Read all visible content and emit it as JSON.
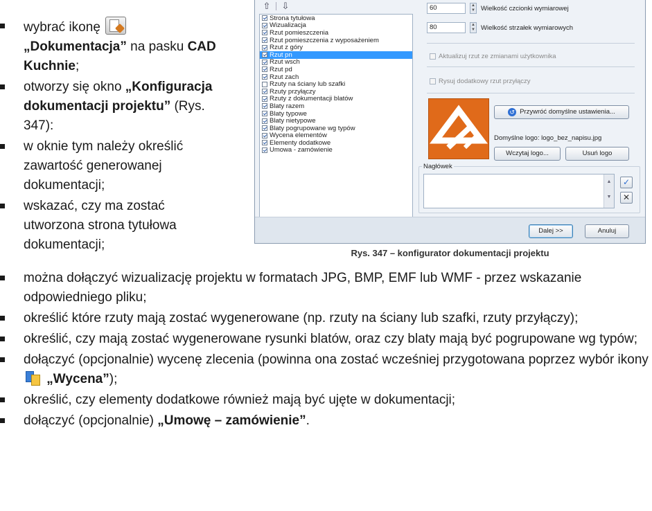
{
  "left_list": {
    "b1": {
      "pre": "wybrać ikonę",
      "bold": "„Dokumentacja”",
      "mid": "na pasku",
      "bold2": "CAD Kuchnie",
      "post": ";"
    },
    "b2": {
      "pre": "otworzy się okno",
      "bold": "„Konfiguracja dokumentacji projektu”",
      "post": "(Rys. 347):"
    },
    "b3": "w oknie tym należy określić zawartość generowanej dokumentacji;",
    "b4": "wskazać, czy ma zostać utworzona strona tytułowa dokumentacji;"
  },
  "bottom_list": {
    "b5": "można dołączyć wizualizację projektu w formatach JPG, BMP, EMF lub WMF - przez wskazanie odpowiedniego pliku;",
    "b6": "określić które rzuty mają zostać wygenerowane (np. rzuty na ściany lub szafki, rzuty przyłączy);",
    "b7": "określić, czy mają zostać wygenerowane rysunki blatów, oraz czy blaty mają być pogrupowane wg typów;",
    "b8": {
      "pre": "dołączyć (opcjonalnie) wycenę zlecenia (powinna ona zostać wcześniej przygotowana poprzez wybór ikony",
      "bold": "„Wycena”",
      "post": ");"
    },
    "b9": "określić, czy elementy dodatkowe również mają być ujęte w dokumentacji;",
    "b10": {
      "pre": "dołączyć (opcjonalnie)",
      "bold": "„Umowę – zamówienie”",
      "post": "."
    }
  },
  "icons": {
    "documentation": "documentation-icon",
    "valuation": "valuation-icon"
  },
  "dialog": {
    "items": [
      {
        "label": "Strona tytułowa",
        "checked": true
      },
      {
        "label": "Wizualizacja",
        "checked": true
      },
      {
        "label": "Rzut pomieszczenia",
        "checked": true
      },
      {
        "label": "Rzut pomieszczenia z wyposażeniem",
        "checked": true
      },
      {
        "label": "Rzut z góry",
        "checked": true
      },
      {
        "label": "Rzut pn",
        "checked": true,
        "selected": true
      },
      {
        "label": "Rzut wsch",
        "checked": true
      },
      {
        "label": "Rzut pd",
        "checked": true
      },
      {
        "label": "Rzut zach",
        "checked": true
      },
      {
        "label": "Rzuty na ściany lub szafki",
        "checked": false
      },
      {
        "label": "Rzuty przyłączy",
        "checked": true
      },
      {
        "label": "Rzuty z dokumentacji blatów",
        "checked": true
      },
      {
        "label": "Blaty razem",
        "checked": true
      },
      {
        "label": "Blaty typowe",
        "checked": true
      },
      {
        "label": "Blaty nietypowe",
        "checked": true
      },
      {
        "label": "Blaty pogrupowane wg typów",
        "checked": true
      },
      {
        "label": "Wycena elementów",
        "checked": true
      },
      {
        "label": "Elementy dodatkowe",
        "checked": true
      },
      {
        "label": "Umowa - zamówienie",
        "checked": true
      }
    ],
    "font_size_value": "60",
    "font_size_label": "Wielkość czcionki wymiarowej",
    "arrow_size_value": "80",
    "arrow_size_label": "Wielkość strzałek wymiarowych",
    "update_label": "Aktualizuj rzut ze zmianami użytkownika",
    "extra_plan_label": "Rysuj dodatkowy rzut przyłączy",
    "restore_label": "Przywróć domyślne ustawienia...",
    "default_logo_label": "Domyślne logo:",
    "default_logo_value": "logo_bez_napisu.jpg",
    "load_logo_label": "Wczytaj logo...",
    "remove_logo_label": "Usuń logo",
    "header_label": "Nagłówek",
    "next_label": "Dalej >>",
    "cancel_label": "Anuluj",
    "accent": "#e06a1a"
  },
  "caption": "Rys. 347 – konfigurator dokumentacji projektu"
}
